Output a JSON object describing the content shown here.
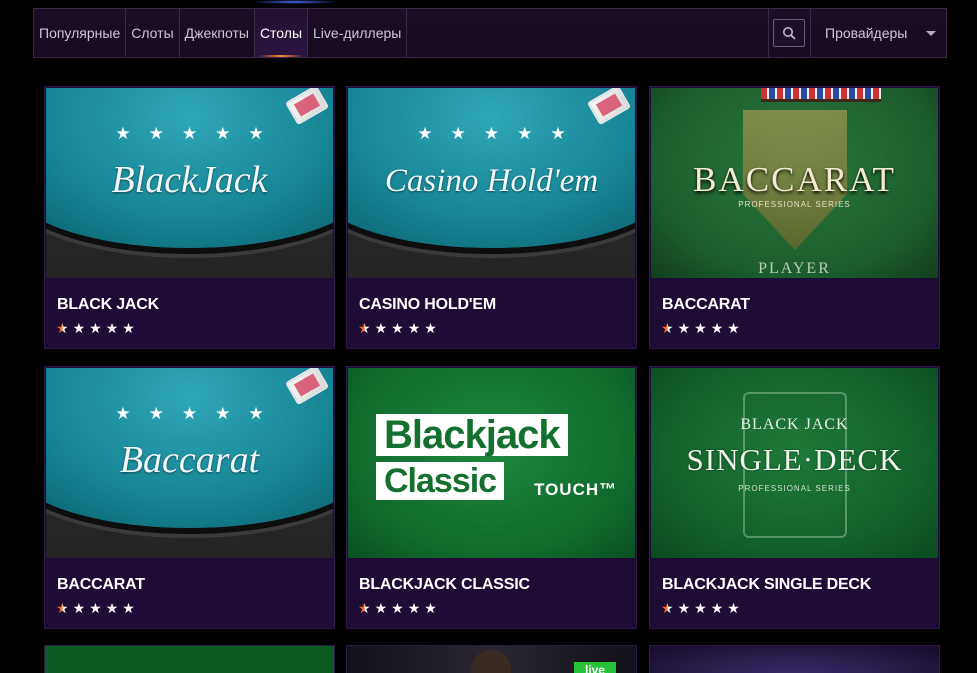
{
  "nav": {
    "tabs": [
      {
        "label": "Популярные"
      },
      {
        "label": "Слоты"
      },
      {
        "label": "Джекпоты"
      },
      {
        "label": "Столы",
        "active": true
      },
      {
        "label": "Live-диллеры"
      }
    ],
    "search_icon": "search-icon",
    "providers_label": "Провайдеры"
  },
  "colors": {
    "nav_bg": "#170b21",
    "card_bg": "#1f0c36",
    "star_accent": "#ff6a1c",
    "active_underline": "#ff8a3c"
  },
  "games": [
    {
      "title": "BLACK JACK",
      "thumb_text": "BlackJack",
      "rating": 0.5,
      "max_rating": 5
    },
    {
      "title": "CASINO HOLD'EM",
      "thumb_text": "Casino Hold'em",
      "rating": 0.5,
      "max_rating": 5
    },
    {
      "title": "BACCARAT",
      "thumb_text": "BACCARAT",
      "thumb_sub": "PROFESSIONAL SERIES",
      "thumb_foot": "PLAYER",
      "rating": 0.5,
      "max_rating": 5
    },
    {
      "title": "BACCARAT",
      "thumb_text": "Baccarat",
      "rating": 0.5,
      "max_rating": 5
    },
    {
      "title": "BLACKJACK CLASSIC",
      "thumb_line1": "Blackjack",
      "thumb_line2": "Classic",
      "thumb_touch": "TOUCH™",
      "rating": 0.5,
      "max_rating": 5
    },
    {
      "title": "BLACKJACK SINGLE DECK",
      "thumb_t1": "BLACK JACK",
      "thumb_t2": "SINGLE·DECK",
      "thumb_t3": "PROFESSIONAL SERIES",
      "rating": 0.5,
      "max_rating": 5
    }
  ],
  "partial_badge": "live"
}
